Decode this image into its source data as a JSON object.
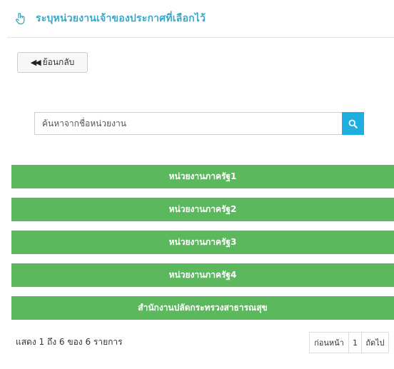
{
  "header": {
    "title": "ระบุหน่วยงานเจ้าของประกาศที่เลือกไว้",
    "icon": "hand-pointer-icon"
  },
  "back_button": {
    "label": "ย้อนกลับ",
    "icon": "backward-icon"
  },
  "search": {
    "placeholder": "ค้นหาจากชื่อหน่วยงาน",
    "value": "",
    "button_icon": "search-icon"
  },
  "departments": [
    {
      "label": "หน่วยงานภาครัฐ1"
    },
    {
      "label": "หน่วยงานภาครัฐ2"
    },
    {
      "label": "หน่วยงานภาครัฐ3"
    },
    {
      "label": "หน่วยงานภาครัฐ4"
    },
    {
      "label": "สำนักงานปลัดกระทรวงสาธารณสุข"
    }
  ],
  "footer": {
    "summary": "แสดง 1 ถึง 6 ของ 6 รายการ",
    "pagination": {
      "prev": "ก่อนหน้า",
      "current": "1",
      "next": "ถัดไป"
    }
  },
  "colors": {
    "title": "#3ba7c7",
    "department_button": "#5cb85c",
    "search_button": "#1eaee0"
  }
}
